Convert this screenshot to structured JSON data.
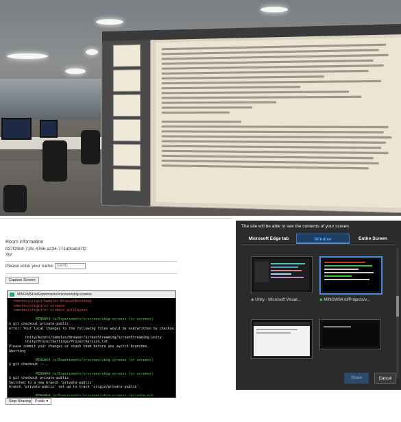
{
  "room": {
    "heading": "Room information",
    "room_id": "b37f29c8-71fe-4766-a234-771a9cab37f2",
    "room_code": "xkz",
    "name_prompt": "Please enter your name:",
    "name_value": "User91",
    "capture_button": "Capture Screen",
    "stop_sharing_button": "Stop Sharing",
    "visibility_select": "Public"
  },
  "terminal": {
    "title": "MINGW64:/e/Experiments/vrscreen/ubig-screens",
    "lines": [
      {
        "text": "  remotes/origin/Samples-BrowserExtended",
        "color": "red"
      },
      {
        "text": "  remotes/origin/vr-screens",
        "color": "red"
      },
      {
        "text": "  remotes/origin/vr-screens_autolayout",
        "color": "red"
      },
      {
        "text": "",
        "color": ""
      },
      {
        "text": "             MINGW64 /e/Experiments/vrscreen/ubig-screens (vr-screens)",
        "color": "green"
      },
      {
        "text": "$ git checkout private-public",
        "color": ""
      },
      {
        "text": "error: Your local changes to the following files would be overwritten by checkout",
        "color": ""
      },
      {
        "text": ":",
        "color": ""
      },
      {
        "text": "        Unity/Assets/Samples/Browser/ScreenStreaming/ScreenStreaming.unity",
        "color": ""
      },
      {
        "text": "        Unity/ProjectSettings/ProjectVersion.txt",
        "color": ""
      },
      {
        "text": "Please commit your changes or stash them before you switch branches.",
        "color": ""
      },
      {
        "text": "Aborting",
        "color": ""
      },
      {
        "text": "",
        "color": ""
      },
      {
        "text": "             MINGW64 /e/Experiments/vrscreen/ubig-screens (vr-screens)",
        "color": "green"
      },
      {
        "text": "$ git checkout -- .",
        "color": ""
      },
      {
        "text": "",
        "color": ""
      },
      {
        "text": "             MINGW64 /e/Experiments/vrscreen/ubig-screens (vr-screens)",
        "color": "green"
      },
      {
        "text": "$ git checkout private-public",
        "color": ""
      },
      {
        "text": "Switched to a new branch 'private-public'",
        "color": ""
      },
      {
        "text": "branch 'private-public' set up to track 'origin/private-public'.",
        "color": ""
      },
      {
        "text": "",
        "color": ""
      },
      {
        "text": "             MINGW64 /e/Experiments/vrscreen/ubig-screens (private-pub",
        "color": "green"
      },
      {
        "text": "$ cd",
        "color": ""
      }
    ]
  },
  "share_dialog": {
    "title": "The site will be able to see the contents of your screen",
    "tabs": [
      {
        "label": "Microsoft Edge tab",
        "selected": false
      },
      {
        "label": "Window",
        "selected": true
      },
      {
        "label": "Entire Screen",
        "selected": false
      }
    ],
    "windows": [
      {
        "label": "Unity - Microsoft Visual...",
        "icon": "visual-studio-icon"
      },
      {
        "label": "MINGW64:/d/Projects/v...",
        "icon": "git-bash-icon"
      },
      {
        "label": "",
        "icon": ""
      },
      {
        "label": "",
        "icon": ""
      }
    ],
    "share_button": "Share",
    "cancel_button": "Cancel"
  },
  "colors": {
    "dialog_bg": "#2b2b2b",
    "accent": "#4a90e2",
    "terminal_bg": "#000000"
  }
}
